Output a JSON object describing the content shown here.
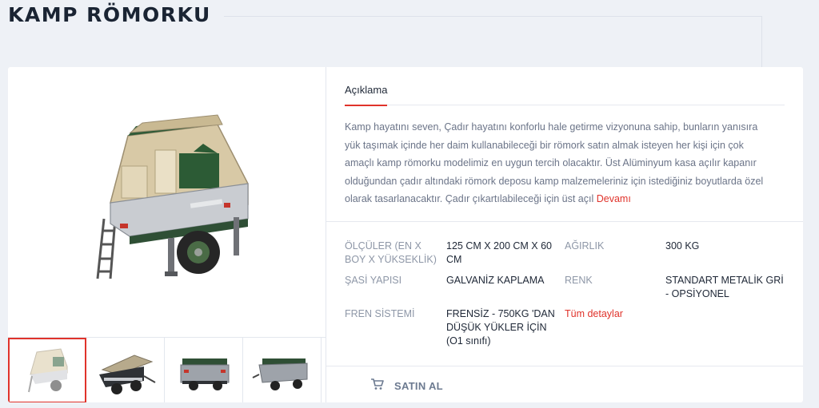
{
  "page": {
    "title": "KAMP RÖMORKU"
  },
  "tabs": [
    {
      "label": "Açıklama",
      "active": true
    }
  ],
  "description": {
    "text": "Kamp hayatını seven, Çadır hayatını konforlu hale getirme vizyonuna sahip, bunların yanısıra yük taşımak içinde her daim kullanabileceği bir römork satın almak isteyen her kişi için çok amaçlı kamp römorku modelimiz en uygun tercih olacaktır. Üst Alüminyum kasa açılır kapanır olduğundan çadır altındaki römork deposu kamp malzemeleriniz için istediğiniz boyutlarda özel olarak tasarlanacaktır. Çadır çıkartılabileceği için üst açıl",
    "more_label": "Devamı"
  },
  "specs": {
    "dimensions_label": "ÖLÇÜLER (EN X BOY X YÜKSEKLİK)",
    "dimensions_value": "125 CM X 200 CM X 60 CM",
    "weight_label": "AĞIRLIK",
    "weight_value": "300 KG",
    "chassis_label": "ŞASİ YAPISI",
    "chassis_value": "GALVANİZ KAPLAMA",
    "color_label": "RENK",
    "color_value": "STANDART METALİK GRİ - OPSİYONEL",
    "brake_label": "FREN SİSTEMİ",
    "brake_value": "FRENSİZ - 750KG 'DAN DÜŞÜK YÜKLER İÇİN (O1 sınıfı)",
    "details_link": "Tüm detaylar"
  },
  "buy": {
    "label": "SATIN AL",
    "icon": "cart-icon"
  },
  "colors": {
    "accent": "#e0332b",
    "title": "#1a2433",
    "text": "#6b7488",
    "background": "#eef1f6"
  }
}
